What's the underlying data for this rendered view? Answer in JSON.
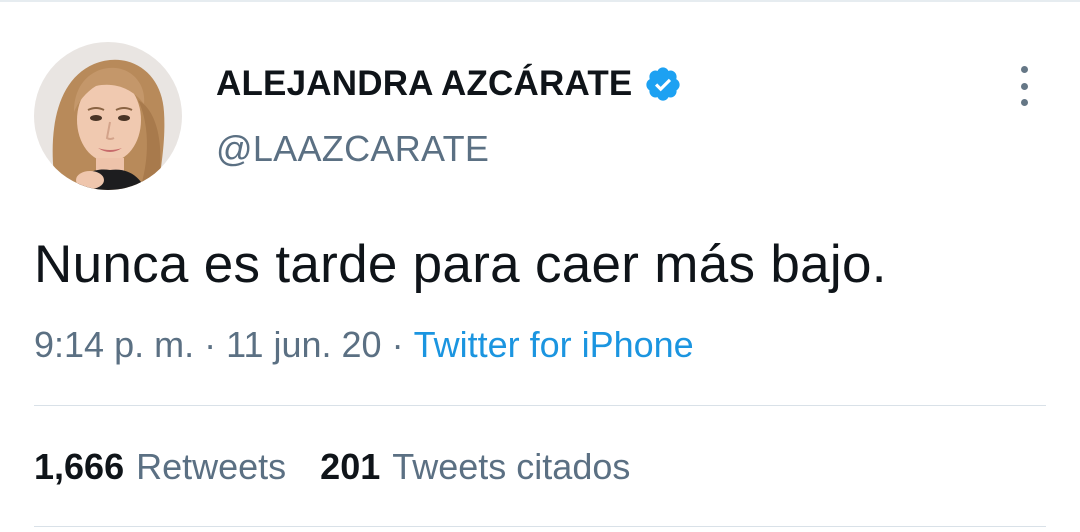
{
  "tweet": {
    "author": {
      "display_name": "ALEJANDRA AZCÁRATE",
      "handle": "@LAAZCARATE",
      "verified_icon": "verified-badge-icon"
    },
    "text": "Nunca es tarde para caer más bajo.",
    "time": "9:14 p. m.",
    "date": "11 jun. 20",
    "separator": "·",
    "source": "Twitter for iPhone",
    "stats": {
      "retweets_count": "1,666",
      "retweets_label": "Retweets",
      "quotes_count": "201",
      "quotes_label": "Tweets citados"
    },
    "more_icon": "more-vertical-icon"
  },
  "colors": {
    "text_primary": "#0f1419",
    "text_secondary": "#5b7083",
    "link_blue": "#1b95e0",
    "verified_blue": "#1da1f2"
  }
}
